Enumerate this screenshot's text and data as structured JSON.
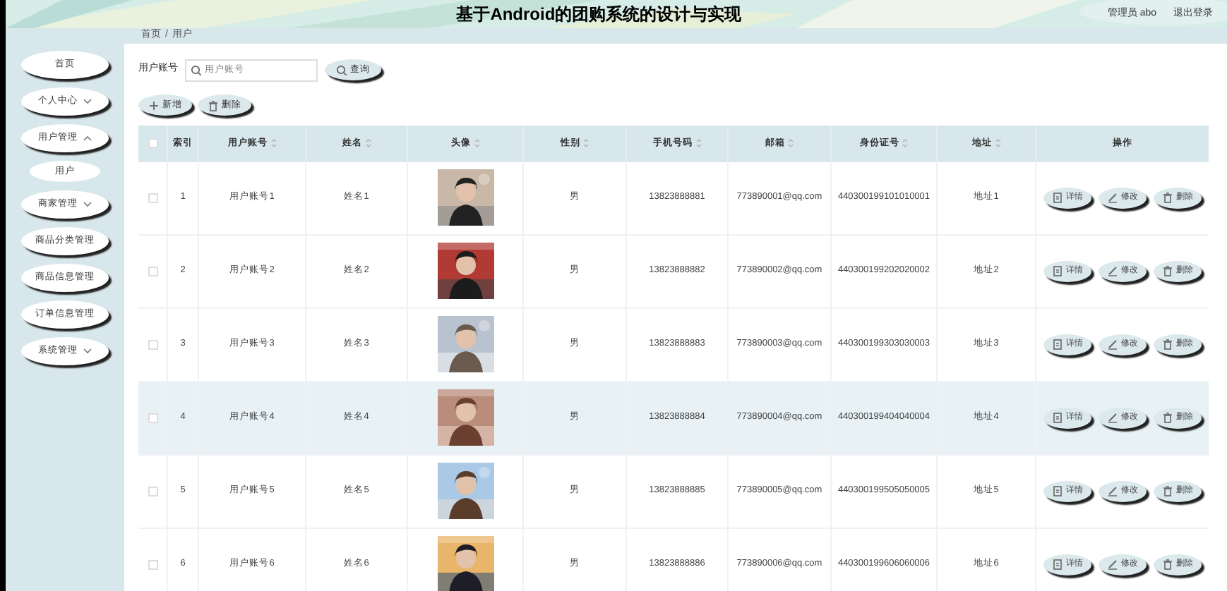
{
  "header": {
    "title": "基于Android的团购系统的设计与实现",
    "user": "管理员 abo",
    "logout": "退出登录"
  },
  "sidebar": {
    "items": [
      {
        "label": "首页",
        "has_submenu": false
      },
      {
        "label": "个人中心",
        "has_submenu": true,
        "expanded": false
      },
      {
        "label": "用户管理",
        "has_submenu": true,
        "expanded": true,
        "children": [
          {
            "label": "用户"
          }
        ]
      },
      {
        "label": "商家管理",
        "has_submenu": true,
        "expanded": false
      },
      {
        "label": "商品分类管理",
        "has_submenu": false
      },
      {
        "label": "商品信息管理",
        "has_submenu": false
      },
      {
        "label": "订单信息管理",
        "has_submenu": false
      },
      {
        "label": "系统管理",
        "has_submenu": true,
        "expanded": false
      }
    ]
  },
  "breadcrumb": {
    "items": [
      "首页",
      "用户"
    ],
    "separator": "/"
  },
  "search": {
    "label": "用户账号",
    "placeholder": "用户账号",
    "button": "查询"
  },
  "toolbar": [
    "新增",
    "删除"
  ],
  "table": {
    "all_checked": false,
    "columns": [
      {
        "label": "索引",
        "sortable": false
      },
      {
        "label": "用户账号",
        "sortable": true
      },
      {
        "label": "姓名",
        "sortable": true
      },
      {
        "label": "头像",
        "sortable": true
      },
      {
        "label": "性别",
        "sortable": true
      },
      {
        "label": "手机号码",
        "sortable": true
      },
      {
        "label": "邮箱",
        "sortable": true
      },
      {
        "label": "身份证号",
        "sortable": true
      },
      {
        "label": "地址",
        "sortable": true
      },
      {
        "label": "操作",
        "sortable": false
      }
    ],
    "rows": [
      {
        "index": "1",
        "account": "用户账号1",
        "name": "姓名1",
        "gender": "男",
        "phone": "13823888881",
        "email": "773890001@qq.com",
        "id_number": "440300199101010001",
        "address": "地址1",
        "actions": [
          "详情",
          "修改",
          "删除"
        ],
        "checked": false,
        "selected": false
      },
      {
        "index": "2",
        "account": "用户账号2",
        "name": "姓名2",
        "gender": "男",
        "phone": "13823888882",
        "email": "773890002@qq.com",
        "id_number": "440300199202020002",
        "address": "地址2",
        "actions": [
          "详情",
          "修改",
          "删除"
        ],
        "checked": false,
        "selected": false
      },
      {
        "index": "3",
        "account": "用户账号3",
        "name": "姓名3",
        "gender": "男",
        "phone": "13823888883",
        "email": "773890003@qq.com",
        "id_number": "440300199303030003",
        "address": "地址3",
        "actions": [
          "详情",
          "修改",
          "删除"
        ],
        "checked": false,
        "selected": false
      },
      {
        "index": "4",
        "account": "用户账号4",
        "name": "姓名4",
        "gender": "男",
        "phone": "13823888884",
        "email": "773890004@qq.com",
        "id_number": "440300199404040004",
        "address": "地址4",
        "actions": [
          "详情",
          "修改",
          "删除"
        ],
        "checked": false,
        "selected": true
      },
      {
        "index": "5",
        "account": "用户账号5",
        "name": "姓名5",
        "gender": "男",
        "phone": "13823888885",
        "email": "773890005@qq.com",
        "id_number": "440300199505050005",
        "address": "地址5",
        "actions": [
          "详情",
          "修改",
          "删除"
        ],
        "checked": false,
        "selected": false
      },
      {
        "index": "6",
        "account": "用户账号6",
        "name": "姓名6",
        "gender": "男",
        "phone": "13823888886",
        "email": "773890006@qq.com",
        "id_number": "440300199606060006",
        "address": "地址6",
        "actions": [
          "详情",
          "修改",
          "删除"
        ],
        "checked": false,
        "selected": false
      }
    ]
  }
}
